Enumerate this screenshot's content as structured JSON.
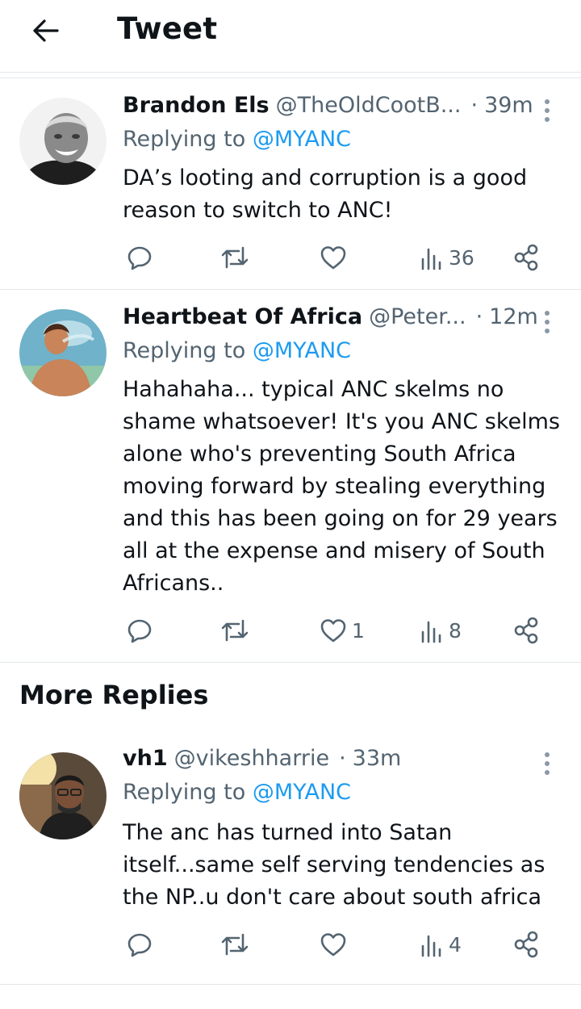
{
  "header": {
    "title": "Tweet"
  },
  "replies": [
    {
      "name": "Brandon Els",
      "handle": "@TheOldCootB...",
      "dot": "·",
      "time": "39m",
      "replying_prefix": "Replying to",
      "replying_mention": "@MYANC",
      "text": "DA’s looting and corruption is a good reason to switch to ANC!",
      "likes": "",
      "views": "36"
    },
    {
      "name": "Heartbeat Of Africa",
      "handle": "@Peter...",
      "dot": "·",
      "time": "12m",
      "replying_prefix": "Replying to",
      "replying_mention": "@MYANC",
      "text": "Hahahaha... typical ANC skelms no shame whatsoever! It's you ANC skelms alone who's preventing South Africa moving forward by stealing everything and this has been going on for 29 years all at the expense and misery of South Africans..",
      "likes": "1",
      "views": "8"
    }
  ],
  "more_replies": {
    "title": "More Replies",
    "items": [
      {
        "name": "vh1",
        "handle": "@vikeshharrie",
        "dot": "·",
        "time": "33m",
        "replying_prefix": "Replying to",
        "replying_mention": "@MYANC",
        "text": "The anc has turned into Satan itself...same self serving tendencies as the NP..u don't care about south africa",
        "likes": "",
        "views": "4"
      }
    ]
  },
  "icons": {
    "back": "arrow-left-icon",
    "more": "more-vertical-icon",
    "reply": "reply-icon",
    "retweet": "retweet-icon",
    "like": "heart-icon",
    "views": "views-icon",
    "share": "share-icon"
  },
  "colors": {
    "mention": "#1d9bf0",
    "muted": "#536471",
    "text": "#0f1419"
  }
}
